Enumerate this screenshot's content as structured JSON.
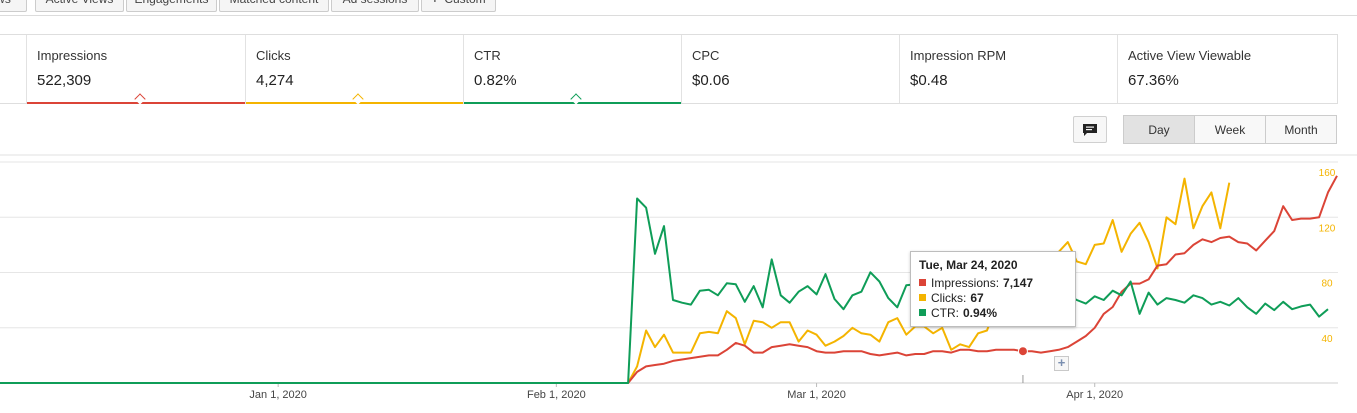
{
  "tabs": [
    {
      "label": "ws"
    },
    {
      "label": "Active Views"
    },
    {
      "label": "Engagements"
    },
    {
      "label": "Matched content"
    },
    {
      "label": "Ad sessions"
    },
    {
      "label": "Custom",
      "icon": "plus-icon"
    }
  ],
  "metrics": [
    {
      "label": "Impressions",
      "value": "522,309",
      "color": "#db4437",
      "selected": true
    },
    {
      "label": "Clicks",
      "value": "4,274",
      "color": "#f4b400",
      "selected": true
    },
    {
      "label": "CTR",
      "value": "0.82%",
      "color": "#0f9d58",
      "selected": true
    },
    {
      "label": "CPC",
      "value": "$0.06",
      "selected": false
    },
    {
      "label": "Impression RPM",
      "value": "$0.48",
      "selected": false
    },
    {
      "label": "Active View Viewable",
      "value": "67.36%",
      "selected": false
    }
  ],
  "toolbar": {
    "annotation_icon": "comment-icon",
    "periods": [
      {
        "label": "Day",
        "active": true
      },
      {
        "label": "Week",
        "active": false
      },
      {
        "label": "Month",
        "active": false
      }
    ]
  },
  "tooltip": {
    "date": "Tue, Mar 24, 2020",
    "rows": [
      {
        "label": "Impressions:",
        "value": "7,147",
        "color": "#db4437"
      },
      {
        "label": "Clicks:",
        "value": "67",
        "color": "#f4b400"
      },
      {
        "label": "CTR:",
        "value": "0.94%",
        "color": "#0f9d58"
      }
    ]
  },
  "chart_data": {
    "type": "line",
    "x_axis_labels": [
      "Jan 1, 2020",
      "Feb 1, 2020",
      "Mar 1, 2020",
      "Apr 1, 2020"
    ],
    "right_axis_ticks": [
      40,
      80,
      120,
      160
    ],
    "right_axis_color": "#f4b400",
    "grid": true,
    "start_date": "2019-12-01",
    "series": [
      {
        "name": "Impressions",
        "color": "#db4437",
        "scale": "clicks",
        "values": [
          0,
          0,
          0,
          0,
          0,
          0,
          0,
          0,
          0,
          0,
          0,
          0,
          0,
          0,
          0,
          0,
          0,
          0,
          0,
          0,
          0,
          0,
          0,
          0,
          0,
          0,
          0,
          0,
          0,
          0,
          0,
          0,
          0,
          0,
          0,
          0,
          0,
          0,
          0,
          0,
          0,
          0,
          0,
          0,
          0,
          0,
          0,
          0,
          0,
          0,
          0,
          0,
          0,
          0,
          0,
          0,
          0,
          0,
          0,
          0,
          0,
          0,
          0,
          0,
          0,
          0,
          0,
          0,
          0,
          0,
          0,
          8,
          12,
          13,
          14,
          16,
          17,
          18,
          19,
          20,
          20,
          24,
          29,
          27,
          22,
          22,
          26,
          27,
          28,
          27,
          26,
          23,
          22,
          22,
          23,
          23,
          23,
          21,
          20,
          21,
          22,
          20,
          21,
          21,
          23,
          23,
          22,
          24,
          24,
          23,
          23,
          24,
          24,
          24,
          23,
          23,
          22,
          23,
          24,
          26,
          30,
          34,
          40,
          50,
          55,
          66,
          72,
          72,
          75,
          85,
          86,
          93,
          94,
          100,
          104,
          102,
          105,
          106,
          102,
          101,
          96,
          103,
          110,
          128,
          118,
          119,
          119,
          120,
          138,
          150
        ]
      },
      {
        "name": "Clicks",
        "color": "#f4b400",
        "scale": "clicks",
        "values": [
          0,
          0,
          0,
          0,
          0,
          0,
          0,
          0,
          0,
          0,
          0,
          0,
          0,
          0,
          0,
          0,
          0,
          0,
          0,
          0,
          0,
          0,
          0,
          0,
          0,
          0,
          0,
          0,
          0,
          0,
          0,
          0,
          0,
          0,
          0,
          0,
          0,
          0,
          0,
          0,
          0,
          0,
          0,
          0,
          0,
          0,
          0,
          0,
          0,
          0,
          0,
          0,
          0,
          0,
          0,
          0,
          0,
          0,
          0,
          0,
          0,
          0,
          0,
          0,
          0,
          0,
          0,
          0,
          0,
          0,
          0,
          12,
          38,
          26,
          35,
          22,
          22,
          22,
          36,
          37,
          36,
          52,
          47,
          28,
          45,
          44,
          40,
          44,
          44,
          30,
          38,
          35,
          27,
          30,
          34,
          40,
          36,
          35,
          30,
          44,
          47,
          35,
          41,
          41,
          36,
          40,
          24,
          28,
          26,
          36,
          38,
          56,
          62,
          65,
          72,
          73,
          80,
          55,
          95,
          102,
          88,
          86,
          100,
          101,
          118,
          95,
          108,
          116,
          102,
          83,
          120,
          115,
          148,
          112,
          128,
          138,
          112,
          145
        ]
      },
      {
        "name": "CTR",
        "color": "#0f9d58",
        "scale": "ctr",
        "values": [
          0,
          0,
          0,
          0,
          0,
          0,
          0,
          0,
          0,
          0,
          0,
          0,
          0,
          0,
          0,
          0,
          0,
          0,
          0,
          0,
          0,
          0,
          0,
          0,
          0,
          0,
          0,
          0,
          0,
          0,
          0,
          0,
          0,
          0,
          0,
          0,
          0,
          0,
          0,
          0,
          0,
          0,
          0,
          0,
          0,
          0,
          0,
          0,
          0,
          0,
          0,
          0,
          0,
          0,
          0,
          0,
          0,
          0,
          0,
          0,
          0,
          0,
          0,
          0,
          0,
          0,
          0,
          0,
          0,
          0,
          0,
          2.0,
          1.9,
          1.4,
          1.7,
          0.9,
          0.87,
          0.85,
          1.0,
          1.01,
          0.95,
          1.08,
          1.07,
          0.88,
          1.05,
          0.82,
          1.34,
          0.95,
          0.87,
          0.99,
          1.05,
          0.96,
          1.18,
          0.91,
          0.8,
          0.95,
          0.99,
          1.2,
          1.1,
          0.92,
          0.82,
          1.06,
          1.07,
          0.9,
          1.05,
          1.01,
          1.13,
          0.91,
          0.95,
          0.94,
          0.88,
          0.85,
          0.92,
          0.88,
          0.98,
          0.87,
          0.83,
          0.92,
          0.88,
          0.95,
          0.9,
          0.86,
          0.94,
          0.9,
          1.0,
          0.95,
          1.1,
          0.75,
          0.98,
          0.85,
          0.92,
          0.9,
          0.87,
          0.95,
          0.92,
          0.85,
          0.88,
          0.84,
          0.92,
          0.82,
          0.75,
          0.86,
          0.79,
          0.88,
          0.8,
          0.83,
          0.85,
          0.72,
          0.8
        ]
      }
    ],
    "highlight": {
      "date": "Tue, Mar 24, 2020"
    }
  }
}
